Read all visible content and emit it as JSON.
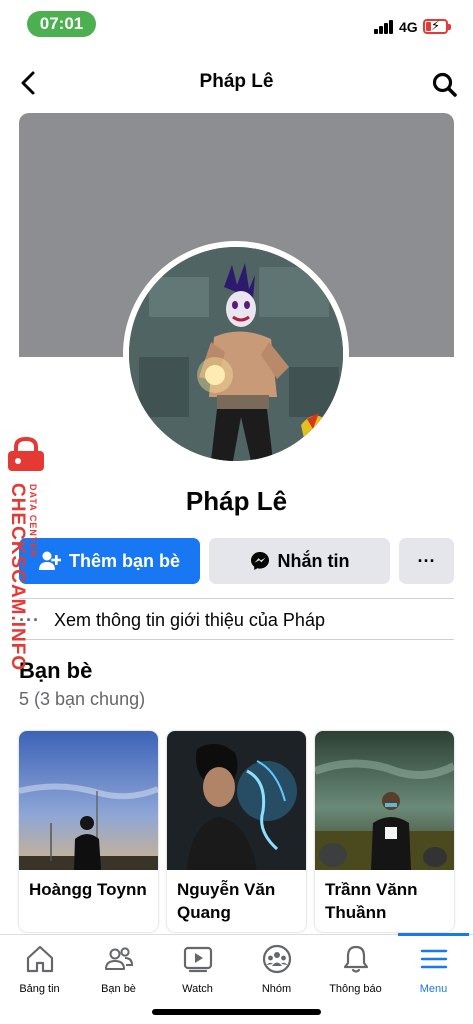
{
  "status_bar": {
    "time": "07:01",
    "network": "4G"
  },
  "header": {
    "title": "Pháp Lê"
  },
  "profile": {
    "name": "Pháp Lê"
  },
  "actions": {
    "add_friend_label": "Thêm bạn bè",
    "message_label": "Nhắn tin",
    "more_label": "···"
  },
  "intro": {
    "dots": "···",
    "label": "Xem thông tin giới thiệu của Pháp"
  },
  "friends": {
    "title": "Bạn bè",
    "count": "5 (3 bạn chung)",
    "items": [
      {
        "name": "Hoàngg Toynn"
      },
      {
        "name": "Nguyễn Văn Quang"
      },
      {
        "name": "Trầnn Vănn Thuầnn"
      }
    ]
  },
  "watermark": {
    "brand": "CHECKSCAM.INFO",
    "sub": "DATA CENTER"
  },
  "bottom_nav": {
    "items": [
      {
        "label": "Bảng tin",
        "icon": "home-icon"
      },
      {
        "label": "Bạn bè",
        "icon": "friends-icon"
      },
      {
        "label": "Watch",
        "icon": "watch-icon"
      },
      {
        "label": "Nhóm",
        "icon": "groups-icon"
      },
      {
        "label": "Thông báo",
        "icon": "bell-icon"
      },
      {
        "label": "Menu",
        "icon": "menu-icon"
      }
    ],
    "active": "Menu"
  },
  "colors": {
    "accent": "#1877f2",
    "cover": "#8c8e91",
    "time_pill": "#4caf50",
    "watermark": "#e53935"
  }
}
